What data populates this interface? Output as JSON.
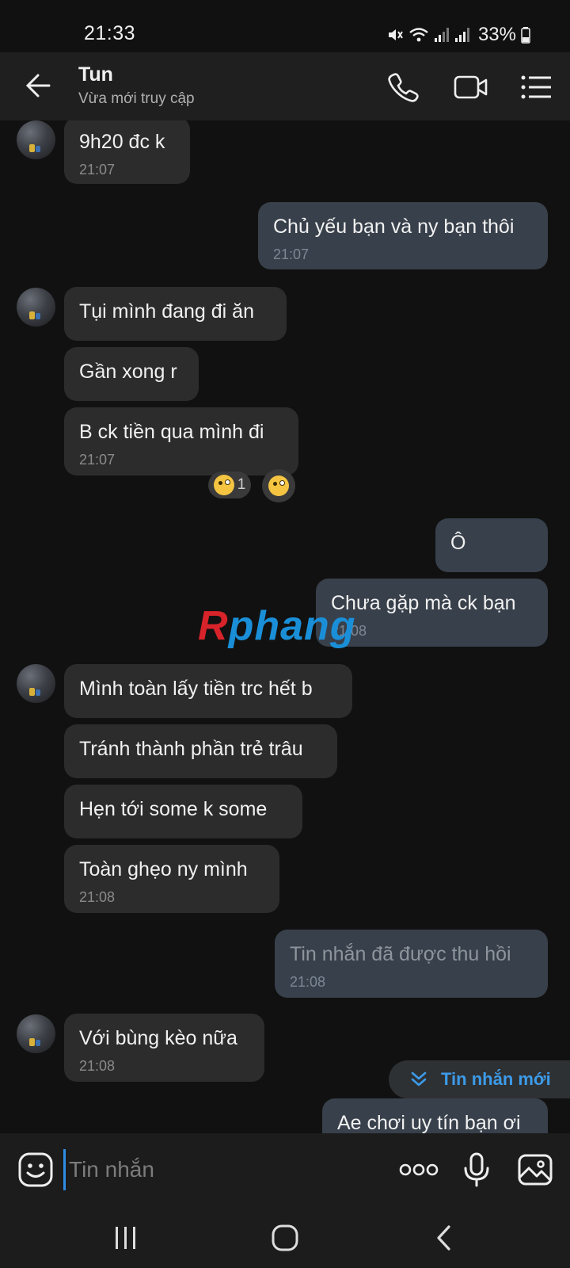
{
  "status_bar": {
    "time": "21:33",
    "battery": "33%"
  },
  "header": {
    "name": "Tun",
    "status": "Vừa mới truy cập"
  },
  "messages": [
    {
      "side": "in",
      "text": "9h20 đc k",
      "time": "21:07"
    },
    {
      "side": "out",
      "text": "Chủ yếu bạn và ny bạn thôi",
      "time": "21:07"
    },
    {
      "side": "in",
      "text": "Tụi mình đang đi ăn"
    },
    {
      "side": "in",
      "text": "Gần xong r"
    },
    {
      "side": "in",
      "text": "B ck tiền qua mình đi",
      "time": "21:07",
      "reaction_count": "1"
    },
    {
      "side": "out",
      "text": "Ô"
    },
    {
      "side": "out",
      "text": "Chưa gặp mà ck bạn",
      "time": "21:08"
    },
    {
      "side": "in",
      "text": "Mình toàn lấy tiền trc hết b"
    },
    {
      "side": "in",
      "text": "Tránh thành phần trẻ trâu"
    },
    {
      "side": "in",
      "text": "Hẹn tới some k some"
    },
    {
      "side": "in",
      "text": "Toàn ghẹo ny mình",
      "time": "21:08"
    },
    {
      "side": "out",
      "text": "Tin nhắn đã được thu hồi",
      "time": "21:08",
      "recalled": true
    },
    {
      "side": "in",
      "text": "Với bùng kèo nữa",
      "time": "21:08"
    },
    {
      "side": "out",
      "text": "Ae chơi uy tín bạn ơi"
    }
  ],
  "watermark": {
    "first": "R",
    "rest": "phang"
  },
  "new_message_label": "Tin nhắn mới",
  "composer": {
    "placeholder": "Tin nhắn"
  },
  "colors": {
    "accent": "#3d9be9",
    "incoming_bubble": "#2c2c2c",
    "outgoing_bubble": "#38404b"
  }
}
